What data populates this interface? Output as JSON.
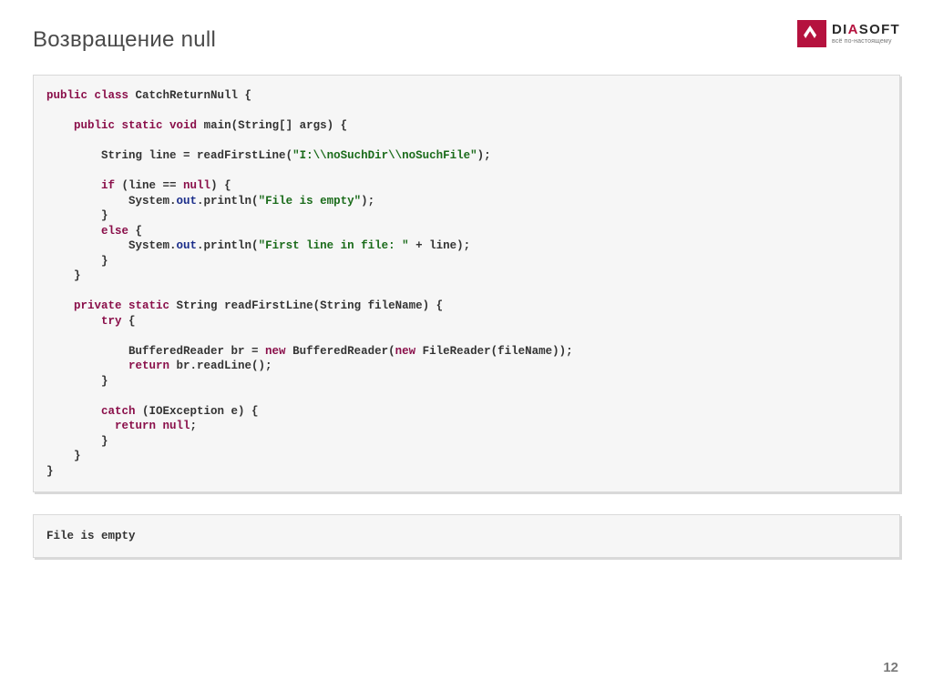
{
  "title": "Возвращение null",
  "logo": {
    "name_plain": "DI",
    "name_accent": "A",
    "name_rest": "SOFT",
    "tagline": "всё по-настоящему"
  },
  "code": {
    "tokens": [
      {
        "c": "kw",
        "t": "public class"
      },
      {
        "t": " CatchReturnNull {"
      },
      {
        "t": "\n\n"
      },
      {
        "t": "    "
      },
      {
        "c": "kw",
        "t": "public static void"
      },
      {
        "t": " "
      },
      {
        "c": "mtd",
        "t": "main"
      },
      {
        "t": "(String[] args) {"
      },
      {
        "t": "\n\n"
      },
      {
        "t": "        String line = "
      },
      {
        "c": "mtd",
        "t": "readFirstLine"
      },
      {
        "t": "("
      },
      {
        "c": "str",
        "t": "\"I:\\\\noSuchDir\\\\noSuchFile\""
      },
      {
        "t": ");"
      },
      {
        "t": "\n\n"
      },
      {
        "t": "        "
      },
      {
        "c": "kw",
        "t": "if"
      },
      {
        "t": " (line == "
      },
      {
        "c": "kw",
        "t": "null"
      },
      {
        "t": ") {"
      },
      {
        "t": "\n"
      },
      {
        "t": "            System."
      },
      {
        "c": "field",
        "t": "out"
      },
      {
        "t": ".println("
      },
      {
        "c": "str",
        "t": "\"File is empty\""
      },
      {
        "t": ");"
      },
      {
        "t": "\n"
      },
      {
        "t": "        }"
      },
      {
        "t": "\n"
      },
      {
        "t": "        "
      },
      {
        "c": "kw",
        "t": "else"
      },
      {
        "t": " {"
      },
      {
        "t": "\n"
      },
      {
        "t": "            System."
      },
      {
        "c": "field",
        "t": "out"
      },
      {
        "t": ".println("
      },
      {
        "c": "str",
        "t": "\"First line in file: \""
      },
      {
        "t": " + line);"
      },
      {
        "t": "\n"
      },
      {
        "t": "        }"
      },
      {
        "t": "\n"
      },
      {
        "t": "    }"
      },
      {
        "t": "\n\n"
      },
      {
        "t": "    "
      },
      {
        "c": "kw",
        "t": "private static"
      },
      {
        "t": " String "
      },
      {
        "c": "mtd",
        "t": "readFirstLine"
      },
      {
        "t": "(String fileName) {"
      },
      {
        "t": "\n"
      },
      {
        "t": "        "
      },
      {
        "c": "kw",
        "t": "try"
      },
      {
        "t": " {"
      },
      {
        "t": "\n\n"
      },
      {
        "t": "            BufferedReader br = "
      },
      {
        "c": "kw",
        "t": "new"
      },
      {
        "t": " BufferedReader("
      },
      {
        "c": "kw",
        "t": "new"
      },
      {
        "t": " FileReader(fileName));"
      },
      {
        "t": "\n"
      },
      {
        "t": "            "
      },
      {
        "c": "kw",
        "t": "return"
      },
      {
        "t": " br.readLine();"
      },
      {
        "t": "\n"
      },
      {
        "t": "        }"
      },
      {
        "t": "\n\n"
      },
      {
        "t": "        "
      },
      {
        "c": "kw",
        "t": "catch"
      },
      {
        "t": " (IOException e) {"
      },
      {
        "t": "\n"
      },
      {
        "t": "          "
      },
      {
        "c": "kw",
        "t": "return null"
      },
      {
        "t": ";"
      },
      {
        "t": "\n"
      },
      {
        "t": "        }"
      },
      {
        "t": "\n"
      },
      {
        "t": "    }"
      },
      {
        "t": "\n"
      },
      {
        "t": "}"
      }
    ]
  },
  "output": "File is empty",
  "page_number": "12"
}
